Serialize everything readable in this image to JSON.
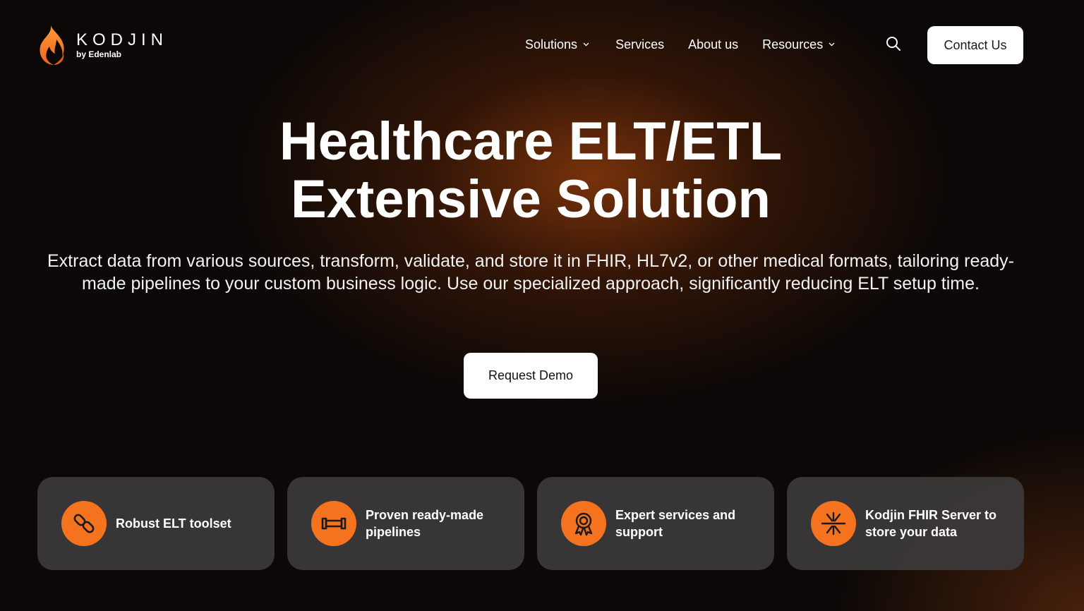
{
  "brand": {
    "name": "KODJIN",
    "subtitle": "by Edenlab",
    "logo_icon": "flame-icon",
    "accent_color": "#f5731f"
  },
  "nav": {
    "items": [
      {
        "label": "Solutions",
        "has_dropdown": true
      },
      {
        "label": "Services",
        "has_dropdown": false
      },
      {
        "label": "About us",
        "has_dropdown": false
      },
      {
        "label": "Resources",
        "has_dropdown": true
      }
    ],
    "search_icon": "search-icon",
    "contact_label": "Contact Us"
  },
  "hero": {
    "title_line1": "Healthcare ELT/ETL",
    "title_line2": "Extensive Solution",
    "description": "Extract data from various sources, transform, validate, and store it in FHIR, HL7v2, or other medical formats, tailoring ready-made pipelines to your custom business logic. Use our specialized approach, significantly reducing ELT setup time.",
    "cta_label": "Request Demo"
  },
  "features": [
    {
      "label": "Robust ELT toolset",
      "icon": "link-chain-icon"
    },
    {
      "label": "Proven ready-made pipelines",
      "icon": "pipeline-icon"
    },
    {
      "label": "Expert services and support",
      "icon": "award-ribbon-icon"
    },
    {
      "label": "Kodjin FHIR Server to store your data",
      "icon": "fhir-star-icon"
    }
  ]
}
